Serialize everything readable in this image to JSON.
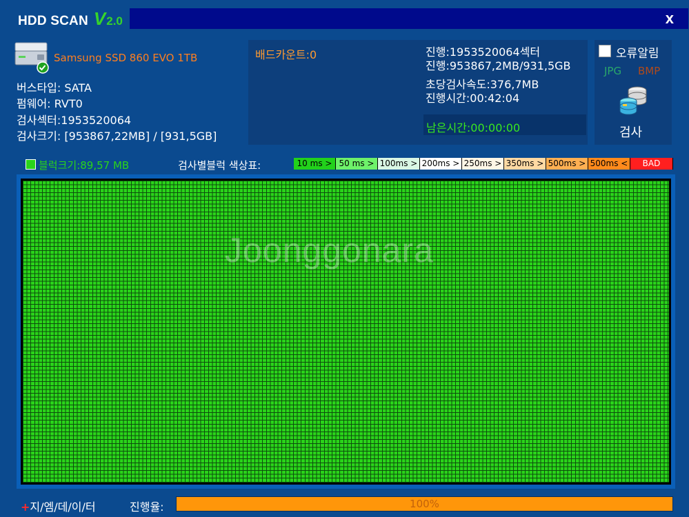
{
  "app": {
    "title": "HDD SCAN",
    "version_letter": "V",
    "version_number": "2.0",
    "close_label": "x"
  },
  "drive": {
    "name": "Samsung SSD 860 EVO 1TB",
    "bus_type": "버스타입: SATA",
    "firmware": "펌웨어: RVT0",
    "scan_sectors": "검사섹터:1953520064",
    "scan_size": "검사크기: [953867,22MB] / [931,5GB]"
  },
  "status": {
    "bad_count": "배드카운트:0",
    "progress_sectors": "진행:1953520064섹터",
    "progress_size": "진행:953867,2MB/931,5GB",
    "speed": "초당검사속도:376,7MB",
    "elapsed": "진행시간:00:42:04",
    "remaining": "남은시간:00:00:00"
  },
  "options": {
    "error_alert_label": "오류알림",
    "error_alert_checked": false,
    "jpg_label": "JPG",
    "bmp_label": "BMP",
    "scan_button_label": "검사",
    "scan_icon": "database-scan-icon",
    "drive_icon": "hard-drive-ok-icon"
  },
  "legend": {
    "block_size": "블럭크기:89,57 MB",
    "title": "검사별블럭 색상표:",
    "items": [
      {
        "label": "10 ms >",
        "color": "#22d11b"
      },
      {
        "label": "50 ms >",
        "color": "#6ef26a"
      },
      {
        "label": "100ms >",
        "color": "#d9f7e4"
      },
      {
        "label": "200ms >",
        "color": "#ffffff"
      },
      {
        "label": "250ms >",
        "color": "#fff6e6"
      },
      {
        "label": "350ms >",
        "color": "#ffd9a3"
      },
      {
        "label": "500ms >",
        "color": "#ffaf52"
      },
      {
        "label": "500ms <",
        "color": "#ff8a1c"
      },
      {
        "label": "BAD",
        "color": "#ff1f1f"
      }
    ]
  },
  "grid": {
    "block_color": "#2ad41a",
    "watermark": "Joonggonara"
  },
  "footer": {
    "brand_plus": "+",
    "brand": "지/엠/데/이/터",
    "progress_label": "진행율:",
    "progress_value": 1.0,
    "progress_text": "100%"
  },
  "colors": {
    "background": "#0b4a8f",
    "title_strip": "#000a8c",
    "panel": "#0d3f7c",
    "accent_green": "#36d42b",
    "accent_orange": "#ff7f1f"
  }
}
